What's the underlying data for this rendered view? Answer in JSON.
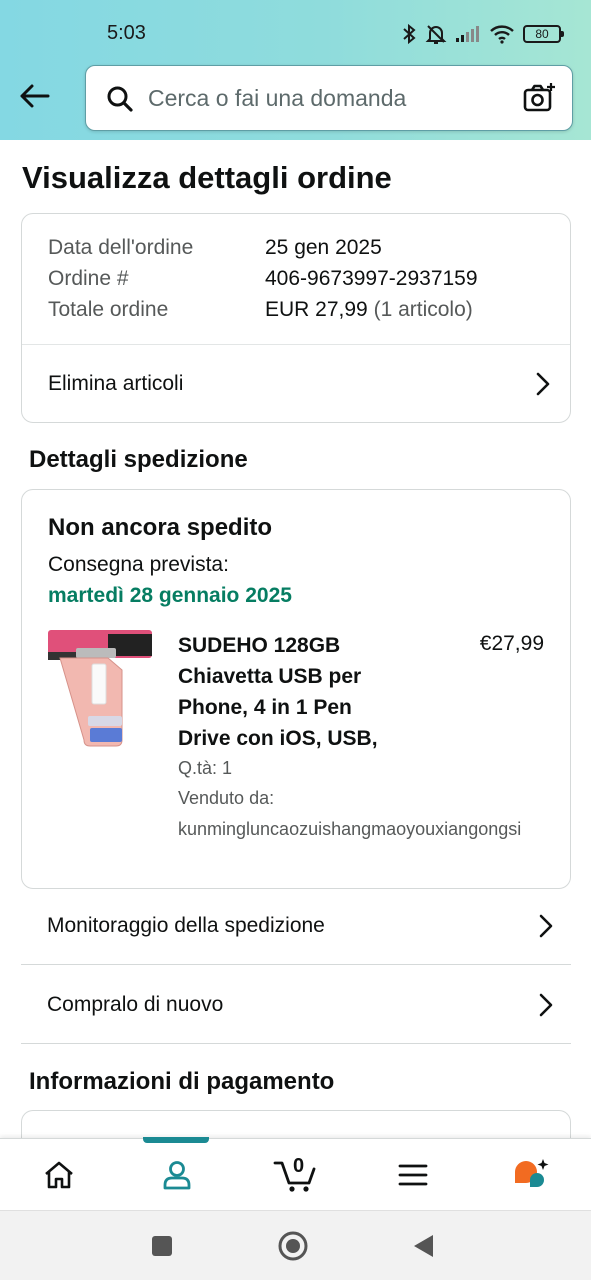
{
  "status_bar": {
    "time": "5:03",
    "battery": "80"
  },
  "search": {
    "placeholder": "Cerca o fai una domanda"
  },
  "page": {
    "title": "Visualizza dettagli ordine"
  },
  "order_summary": {
    "date_label": "Data dell'ordine",
    "date_value": "25 gen 2025",
    "number_label": "Ordine #",
    "number_value": "406-9673997-2937159",
    "total_label": "Totale ordine",
    "total_value": "EUR 27,99",
    "total_items": "(1 articolo)",
    "remove_items_label": "Elimina articoli"
  },
  "shipping": {
    "section_title": "Dettagli spedizione",
    "status": "Non ancora spedito",
    "delivery_label": "Consegna prevista:",
    "delivery_date": "martedì 28 gennaio 2025",
    "product": {
      "name": "SUDEHO 128GB Chiavetta USB per Phone, 4 in 1 Pen Drive con iOS, USB,",
      "price": "€27,99",
      "quantity": "Q.tà: 1",
      "sold_by_label": "Venduto da:",
      "seller": "kunminglunсaozuishangmaoyouxiangongsi"
    }
  },
  "actions": {
    "track_label": "Monitoraggio della spedizione",
    "buy_again_label": "Compralo di nuovo"
  },
  "payment": {
    "section_title": "Informazioni di pagamento"
  },
  "bottom_nav": {
    "cart_count": "0",
    "active_tab": "account"
  },
  "colors": {
    "header_gradient_start": "#84d8e3",
    "header_gradient_end": "#a6e6d4",
    "delivery_green": "#067d62",
    "active_tab": "#1b8a93",
    "rufus_orange": "#f26b21",
    "rufus_teal": "#1b8a93"
  }
}
